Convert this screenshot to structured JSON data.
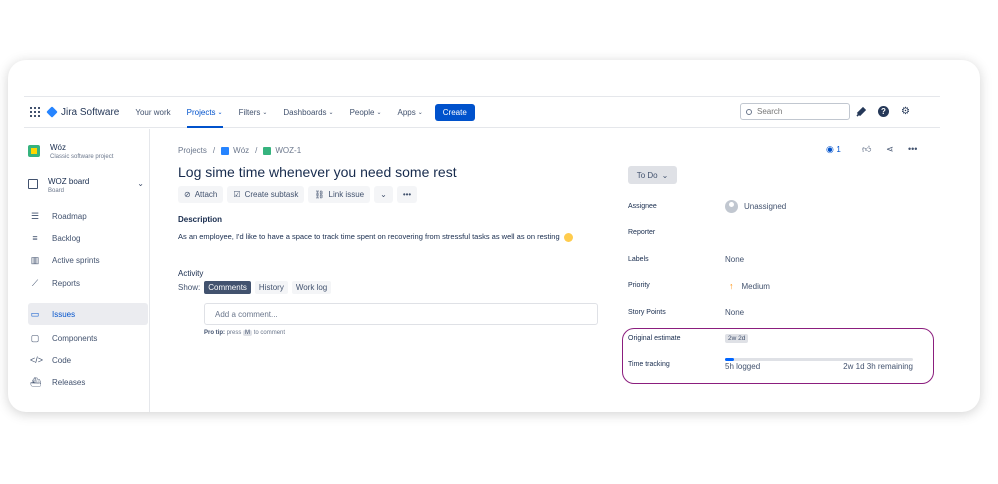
{
  "nav": {
    "logo": "Jira Software",
    "items": [
      {
        "label": "Your work",
        "caret": ""
      },
      {
        "label": "Projects",
        "caret": "⌄"
      },
      {
        "label": "Filters",
        "caret": "⌄"
      },
      {
        "label": "Dashboards",
        "caret": "⌄"
      },
      {
        "label": "People",
        "caret": "⌄"
      },
      {
        "label": "Apps",
        "caret": "⌄"
      }
    ],
    "create_label": "Create",
    "search_placeholder": "Search"
  },
  "sidebar": {
    "project_name": "Wóz",
    "project_type": "Classic software project",
    "board_name": "WOZ board",
    "board_sub": "Board",
    "items": [
      {
        "label": "Roadmap"
      },
      {
        "label": "Backlog"
      },
      {
        "label": "Active sprints"
      },
      {
        "label": "Reports"
      },
      {
        "label": "Issues"
      },
      {
        "label": "Components"
      },
      {
        "label": "Code"
      },
      {
        "label": "Releases"
      }
    ]
  },
  "breadcrumb": {
    "projects": "Projects",
    "project": "Wóz",
    "issue": "WOZ-1",
    "sep": "/"
  },
  "issue": {
    "title": "Log sime time whenever you need some rest",
    "actions": {
      "attach": "Attach",
      "create_subtask": "Create subtask",
      "link_issue": "Link issue"
    },
    "description_label": "Description",
    "description": "As an employee, I'd like to have a space to track time spent on recovering from stressful tasks as well as on resting"
  },
  "activity": {
    "label": "Activity",
    "show_label": "Show:",
    "tabs": [
      "Comments",
      "History",
      "Work log"
    ],
    "comment_placeholder": "Add a comment...",
    "pro_tip_label": "Pro tip:",
    "pro_tip_press": "press",
    "pro_tip_key": "M",
    "pro_tip_suffix": "to comment"
  },
  "right_panel": {
    "watch_count": "1",
    "status": "To Do",
    "fields": {
      "assignee_label": "Assignee",
      "assignee_value": "Unassigned",
      "reporter_label": "Reporter",
      "labels_label": "Labels",
      "labels_value": "None",
      "priority_label": "Priority",
      "priority_value": "Medium",
      "story_points_label": "Story Points",
      "story_points_value": "None",
      "original_estimate_label": "Original estimate",
      "original_estimate_value": "2w 2d",
      "time_tracking_label": "Time tracking",
      "logged": "5h logged",
      "remaining": "2w 1d 3h remaining",
      "logged_fraction": 0.05
    }
  },
  "colors": {
    "accent": "#0052cc",
    "highlight": "#8b1e7e",
    "priority": "#ff8b00"
  }
}
